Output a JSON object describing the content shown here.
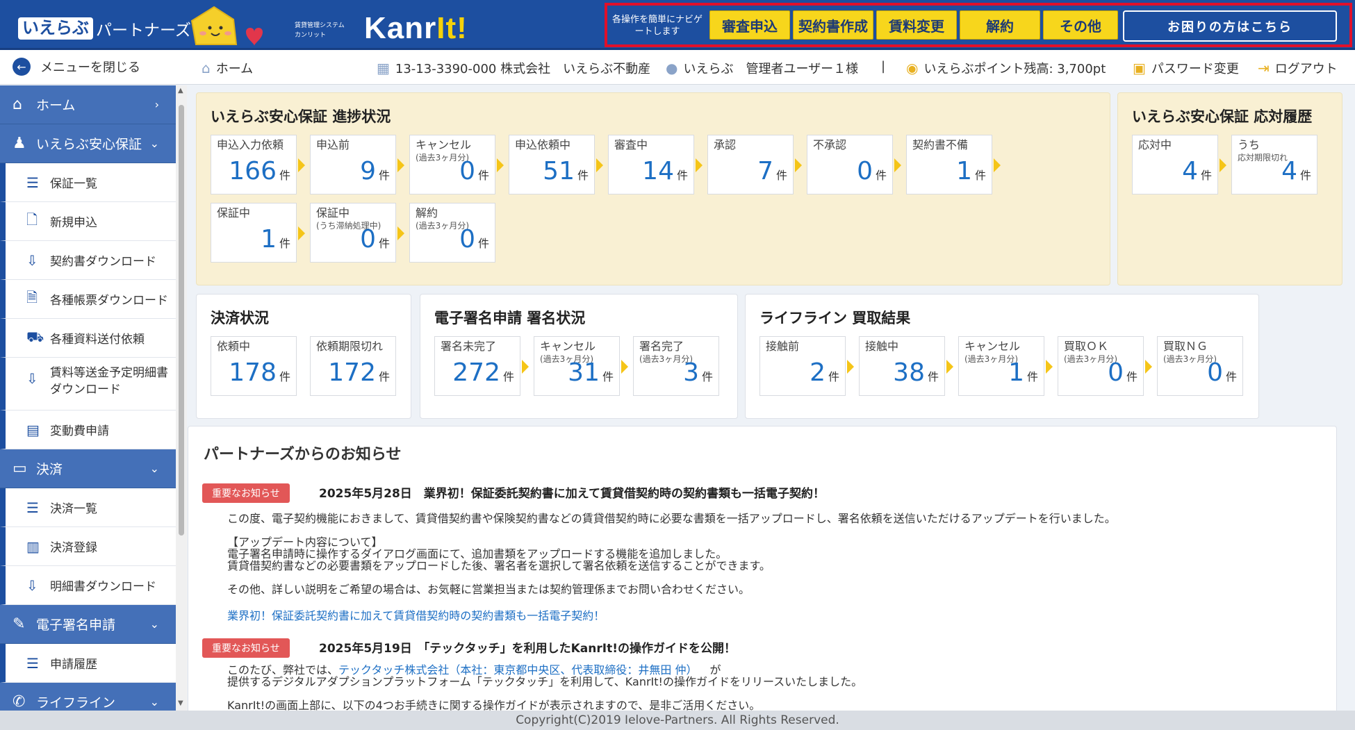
{
  "header": {
    "brand": "いえらぶ",
    "brand_suffix": "パートナーズ",
    "system_sub1": "賃貸管理システム",
    "system_sub2": "カンリット",
    "product_a": "Kanr",
    "product_b": "It!",
    "nav_label": "各操作を簡単にナビゲートします",
    "nav_buttons": [
      "審査申込",
      "契約書作成",
      "賃料変更",
      "解約",
      "その他"
    ],
    "help_button": "お困りの方はこちら"
  },
  "topbar": {
    "close_menu": "メニューを閉じる",
    "home": "ホーム",
    "company": "13-13-3390-000 株式会社　いえらぶ不動産",
    "user": "いえらぶ　管理者ユーザー１様",
    "divider": "|",
    "points": "いえらぶポイント残高: 3,700pt",
    "password": "パスワード変更",
    "logout": "ログアウト"
  },
  "sidebar": {
    "home": "ホーム",
    "guarantee": "いえらぶ安心保証",
    "g_items": [
      "保証一覧",
      "新規申込",
      "契約書ダウンロード",
      "各種帳票ダウンロード",
      "各種資料送付依頼",
      "賃料等送金予定明細書",
      "ダウンロード",
      "変動費申請"
    ],
    "settle": "決済",
    "s_items": [
      "決済一覧",
      "決済登録",
      "明細書ダウンロード"
    ],
    "esign": "電子署名申請",
    "e_items": [
      "申請履歴"
    ],
    "lifeline": "ライフライン"
  },
  "progress": {
    "title": "いえらぶ安心保証 進捗状況",
    "unit": "件",
    "cards": [
      {
        "label": "申込入力依頼",
        "sub": "",
        "value": "166"
      },
      {
        "label": "申込前",
        "sub": "",
        "value": "9"
      },
      {
        "label": "キャンセル",
        "sub": "(過去3ヶ月分)",
        "value": "0"
      },
      {
        "label": "申込依頼中",
        "sub": "",
        "value": "51"
      },
      {
        "label": "審査中",
        "sub": "",
        "value": "14"
      },
      {
        "label": "承認",
        "sub": "",
        "value": "7"
      },
      {
        "label": "不承認",
        "sub": "",
        "value": "0"
      },
      {
        "label": "契約書不備",
        "sub": "",
        "value": "1"
      },
      {
        "label": "保証中",
        "sub": "",
        "value": "1"
      },
      {
        "label": "保証中",
        "sub": "(うち滞納処理中)",
        "value": "0"
      },
      {
        "label": "解約",
        "sub": "(過去3ヶ月分)",
        "value": "0"
      }
    ]
  },
  "history": {
    "title": "いえらぶ安心保証 応対履歴",
    "cards": [
      {
        "label": "応対中",
        "sub": "",
        "value": "4"
      },
      {
        "label": "うち",
        "sub": "応対期限切れ",
        "value": "4"
      }
    ]
  },
  "payment": {
    "title": "決済状況",
    "cards": [
      {
        "label": "依頼中",
        "sub": "",
        "value": "178"
      },
      {
        "label": "依頼期限切れ",
        "sub": "",
        "value": "172"
      }
    ]
  },
  "signature": {
    "title": "電子署名申請 署名状況",
    "cards": [
      {
        "label": "署名未完了",
        "sub": "",
        "value": "272"
      },
      {
        "label": "キャンセル",
        "sub": "(過去3ヶ月分)",
        "value": "31"
      },
      {
        "label": "署名完了",
        "sub": "(過去3ヶ月分)",
        "value": "3"
      }
    ]
  },
  "lifeline": {
    "title": "ライフライン 買取結果",
    "cards": [
      {
        "label": "接触前",
        "sub": "",
        "value": "2"
      },
      {
        "label": "接触中",
        "sub": "",
        "value": "38"
      },
      {
        "label": "キャンセル",
        "sub": "(過去3ヶ月分)",
        "value": "1"
      },
      {
        "label": "買取ＯＫ",
        "sub": "(過去3ヶ月分)",
        "value": "0"
      },
      {
        "label": "買取ＮＧ",
        "sub": "(過去3ヶ月分)",
        "value": "0"
      }
    ]
  },
  "news": {
    "title": "パートナーズからのお知らせ",
    "badge": "重要なお知らせ",
    "n1_title": "2025年5月28日　業界初！保証委託契約書に加えて賃貸借契約時の契約書類も一括電子契約！",
    "n1_p1": "この度、電子契約機能におきまして、賃貸借契約書や保険契約書などの賃貸借契約時に必要な書類を一括アップロードし、署名依頼を送信いただけるアップデートを行いました。",
    "n1_p2": "【アップデート内容について】",
    "n1_p3": "電子署名申請時に操作するダイアログ画面にて、追加書類をアップロードする機能を追加しました。",
    "n1_p4": "賃貸借契約書などの必要書類をアップロードした後、署名者を選択して署名依頼を送信することができます。",
    "n1_p5": "その他、詳しい説明をご希望の場合は、お気軽に営業担当または契約管理係までお問い合わせください。",
    "n1_link": "業界初！保証委託契約書に加えて賃貸借契約時の契約書類も一括電子契約！",
    "n2_title": "2025年5月19日　「テックタッチ」を利用したKanrIt!の操作ガイドを公開！",
    "n2_p1a": "このたび、弊社では、",
    "n2_p1link": "テックタッチ株式会社（本社：東京都中央区、代表取締役：井無田 仲）",
    "n2_p1b": "が",
    "n2_p2": "提供するデジタルアダプションプラットフォーム「テックタッチ」を利用して、KanrIt!の操作ガイドをリリースいたしました。",
    "n2_p3": "KanrIt!の画面上部に、以下の4つお手続きに関する操作ガイドが表示されますので、是非ご活用ください。"
  },
  "footer": "Copyright(C)2019 Ielove-Partners. All Rights Reserved."
}
